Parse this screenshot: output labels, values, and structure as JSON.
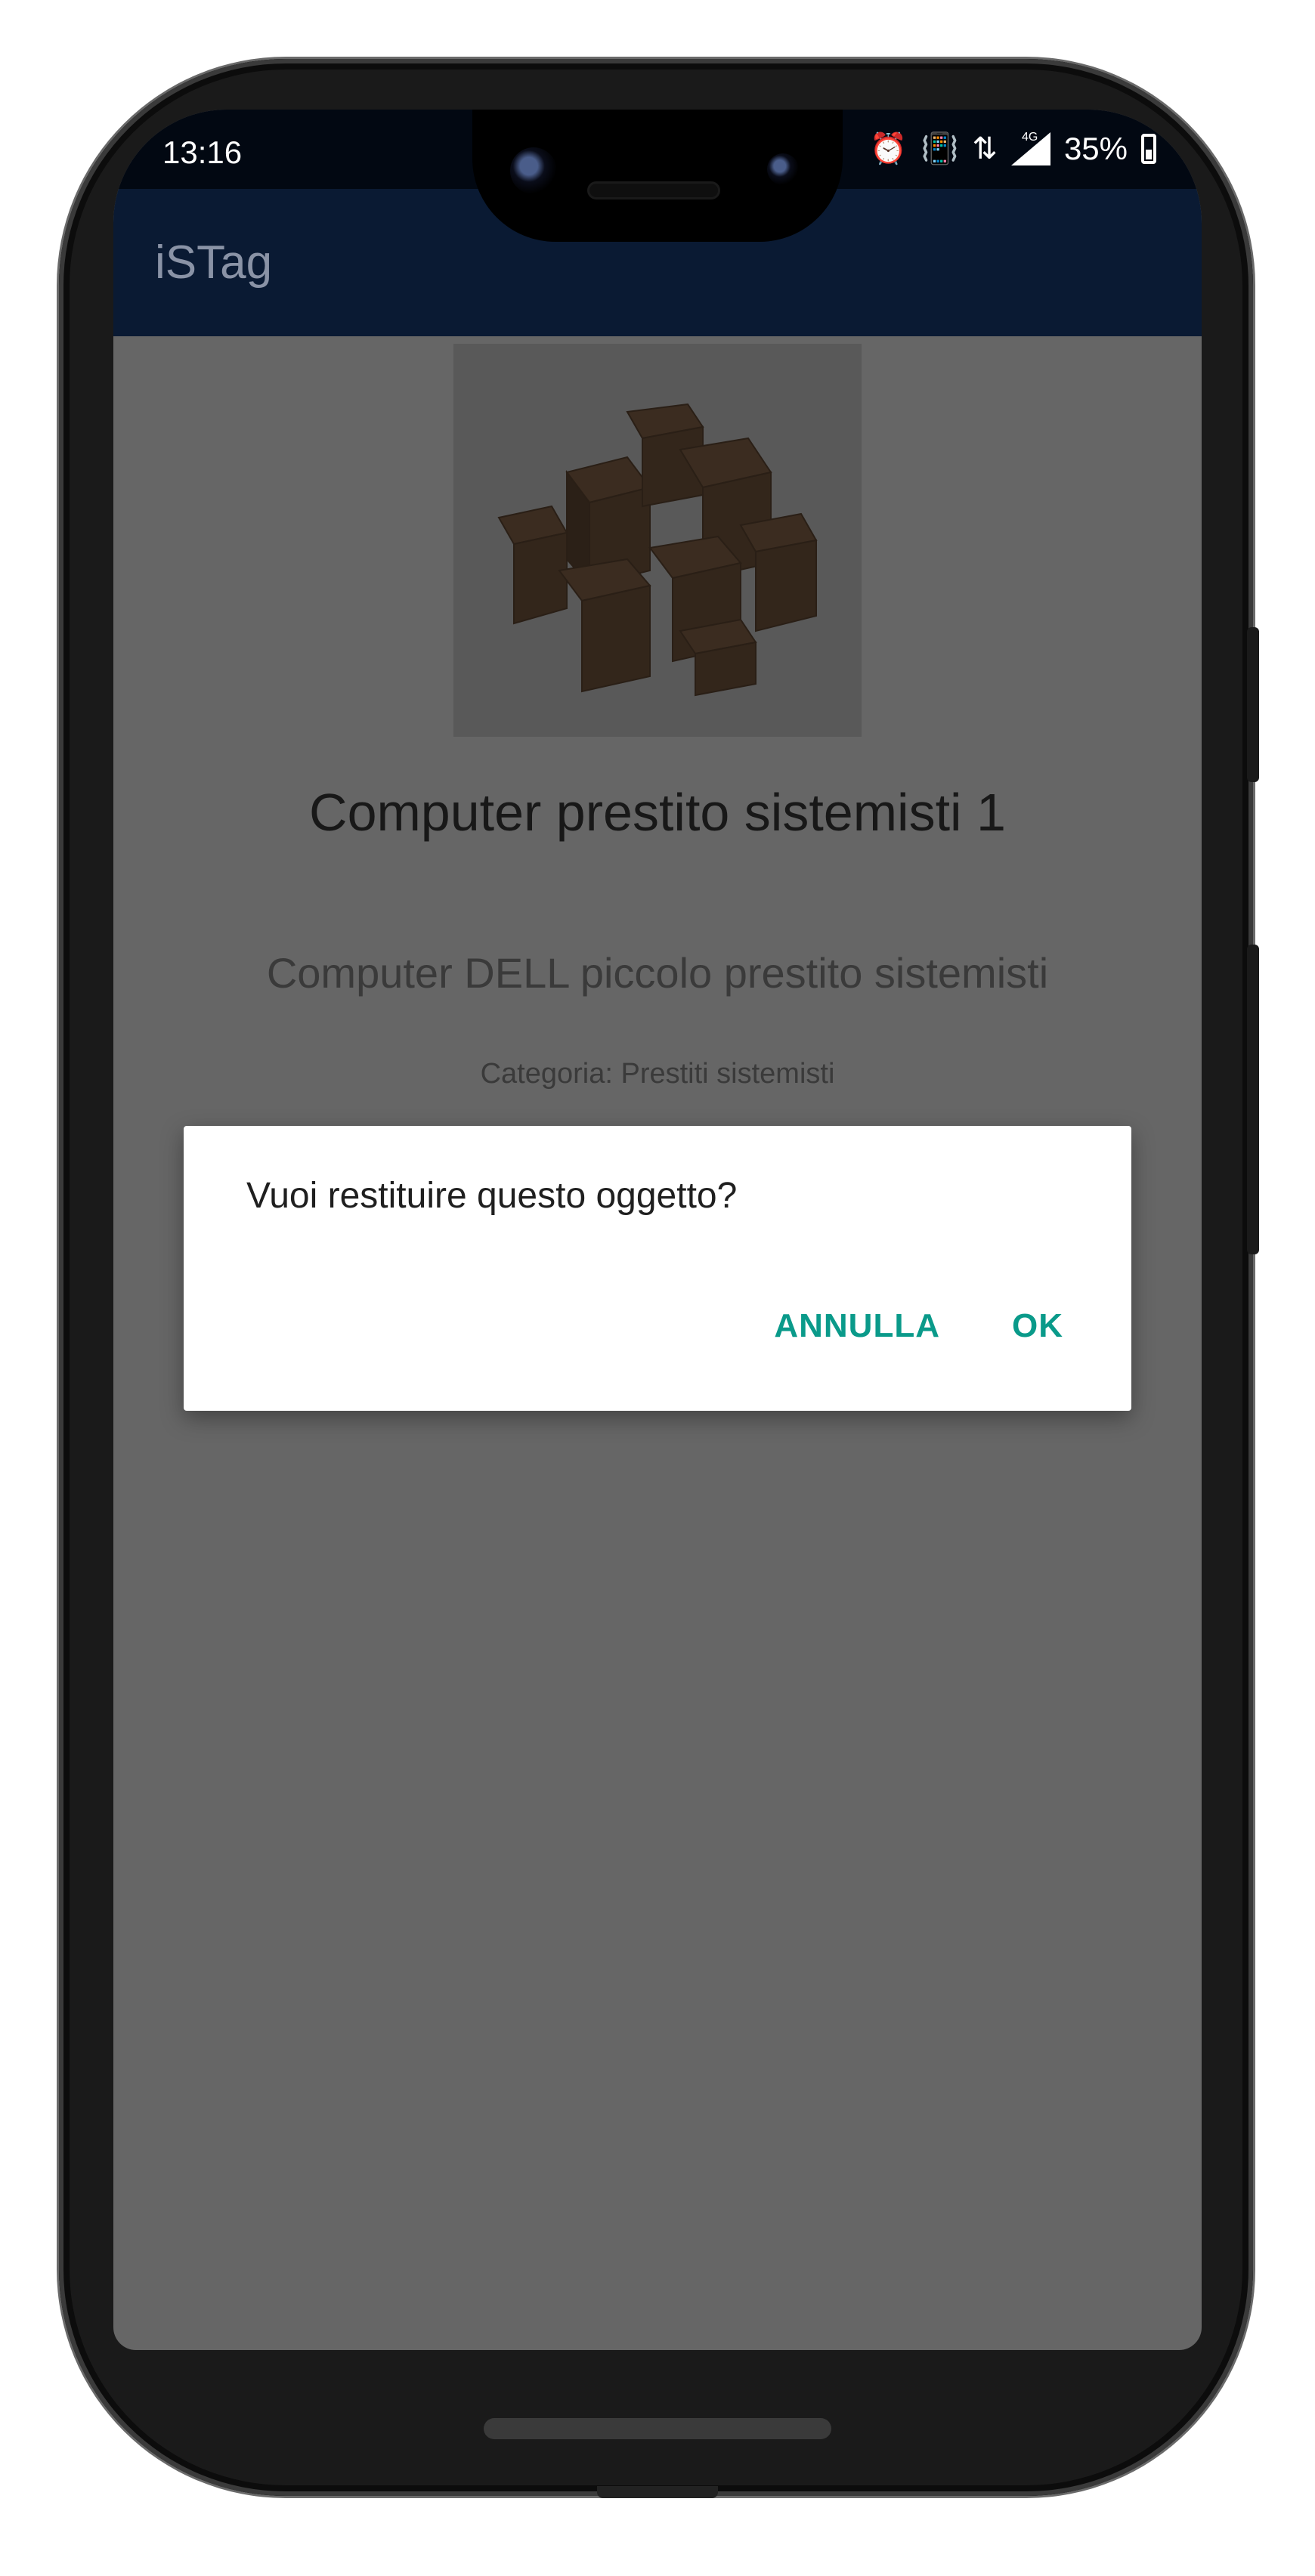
{
  "status_bar": {
    "time": "13:16",
    "network": "4G",
    "battery": "35%",
    "icons": [
      "alarm-icon",
      "vibrate-icon",
      "data-arrows-icon",
      "signal-icon",
      "battery-icon"
    ]
  },
  "app_bar": {
    "title": "iSTag"
  },
  "item": {
    "image": "cardboard-boxes-image",
    "title": "Computer prestito sistemisti 1",
    "description": "Computer DELL piccolo prestito sistemisti",
    "category": "Categoria: Prestiti sistemisti"
  },
  "dialog": {
    "message": "Vuoi restituire questo oggetto?",
    "cancel_label": "ANNULLA",
    "ok_label": "OK"
  },
  "colors": {
    "app_bar": "#0a1a33",
    "accent": "#0a9a8a",
    "scrim": "#666666"
  }
}
